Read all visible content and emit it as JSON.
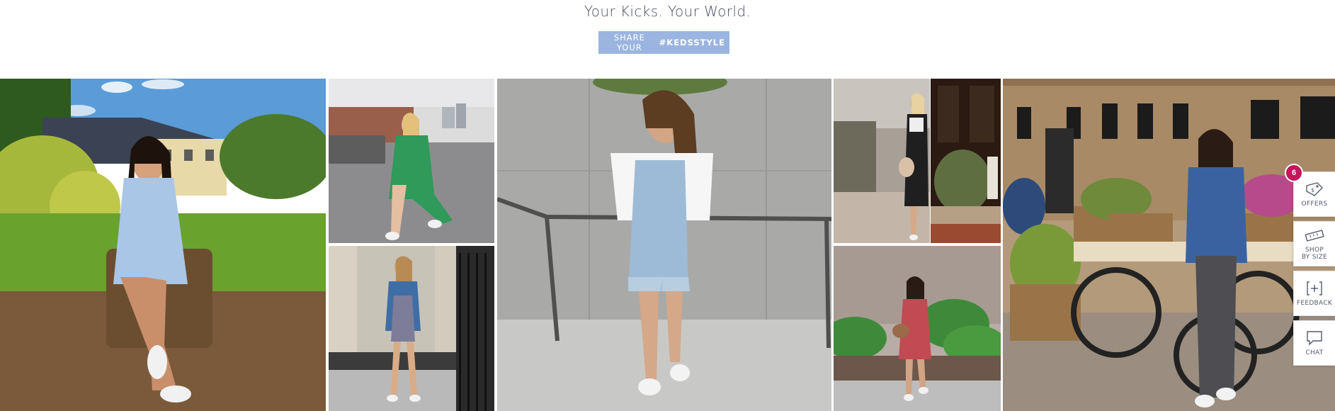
{
  "header": {
    "tagline": "Your Kicks. Your World.",
    "share_prefix": "SHARE YOUR ",
    "share_hashtag": "#KEDSSTYLE",
    "button_color": "#9bb5e0"
  },
  "gallery": {
    "photos": [
      {
        "name": "photo-woman-blue-dress-on-stump"
      },
      {
        "name": "photo-woman-green-dress-sitting"
      },
      {
        "name": "photo-woman-denim-jacket-doorway"
      },
      {
        "name": "photo-woman-denim-overalls"
      },
      {
        "name": "photo-woman-black-overall-dress"
      },
      {
        "name": "photo-shop-window-plant"
      },
      {
        "name": "photo-woman-red-floral-dress"
      },
      {
        "name": "photo-woman-flower-cart"
      }
    ]
  },
  "side_rail": {
    "badge_count": "6",
    "badge_color": "#c2185b",
    "items": [
      {
        "label": "OFFERS",
        "icon": "price-tag-icon"
      },
      {
        "label": "SHOP BY SIZE",
        "icon": "ruler-icon"
      },
      {
        "label": "FEEDBACK",
        "icon": "feedback-icon"
      },
      {
        "label": "CHAT",
        "icon": "chat-bubble-icon"
      }
    ]
  }
}
